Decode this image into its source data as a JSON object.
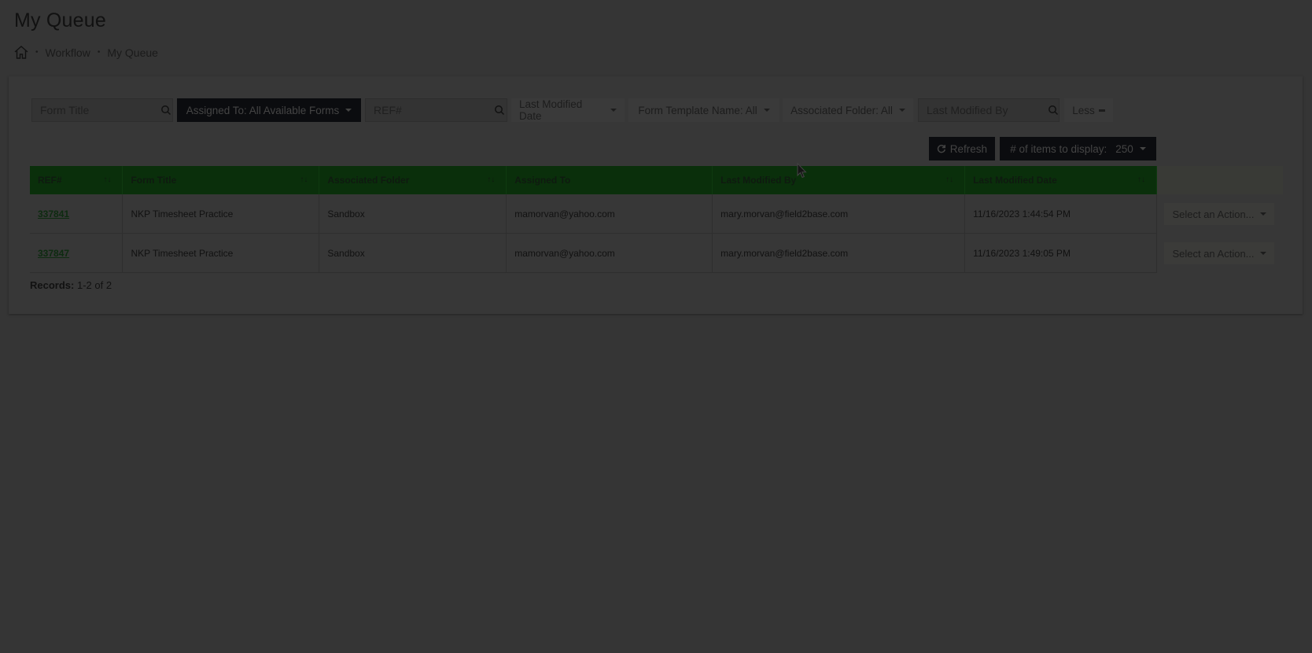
{
  "page": {
    "title": "My Queue"
  },
  "breadcrumb": {
    "items": [
      "Workflow",
      "My Queue"
    ],
    "separator": "•"
  },
  "filters": {
    "form_title_placeholder": "Form Title",
    "assigned_to_label": "Assigned To: All Available Forms",
    "ref_placeholder": "REF#",
    "last_modified_date_label": "Last Modified Date",
    "form_template_label": "Form Template Name: All",
    "associated_folder_label": "Associated Folder: All",
    "last_modified_by_placeholder": "Last Modified By",
    "less_label": "Less"
  },
  "toolbar": {
    "refresh_label": "Refresh",
    "items_display_label": "# of items to display:",
    "items_display_value": "250"
  },
  "table": {
    "columns": [
      "REF#",
      "Form Title",
      "Associated Folder",
      "Assigned To",
      "Last Modified By",
      "Last Modified Date"
    ],
    "rows": [
      {
        "ref": "337841",
        "form_title": "NKP Timesheet Practice",
        "folder": "Sandbox",
        "assigned_to": "mamorvan@yahoo.com",
        "modified_by": "mary.morvan@field2base.com",
        "modified_date": "11/16/2023 1:44:54 PM",
        "action": "Select an Action..."
      },
      {
        "ref": "337847",
        "form_title": "NKP Timesheet Practice",
        "folder": "Sandbox",
        "assigned_to": "mamorvan@yahoo.com",
        "modified_by": "mary.morvan@field2base.com",
        "modified_date": "11/16/2023 1:49:05 PM",
        "action": "Select an Action..."
      }
    ]
  },
  "records": {
    "label": "Records:",
    "value": "1-2 of 2"
  },
  "colors": {
    "overlay_background": "#353535",
    "header_green": "#0a2f0b",
    "dark_button": "#0b0c0f"
  },
  "icons": [
    "home-icon",
    "search-icon",
    "refresh-icon",
    "minus-icon",
    "sort-icon",
    "chevron-down-icon",
    "mouse-cursor-icon"
  ]
}
